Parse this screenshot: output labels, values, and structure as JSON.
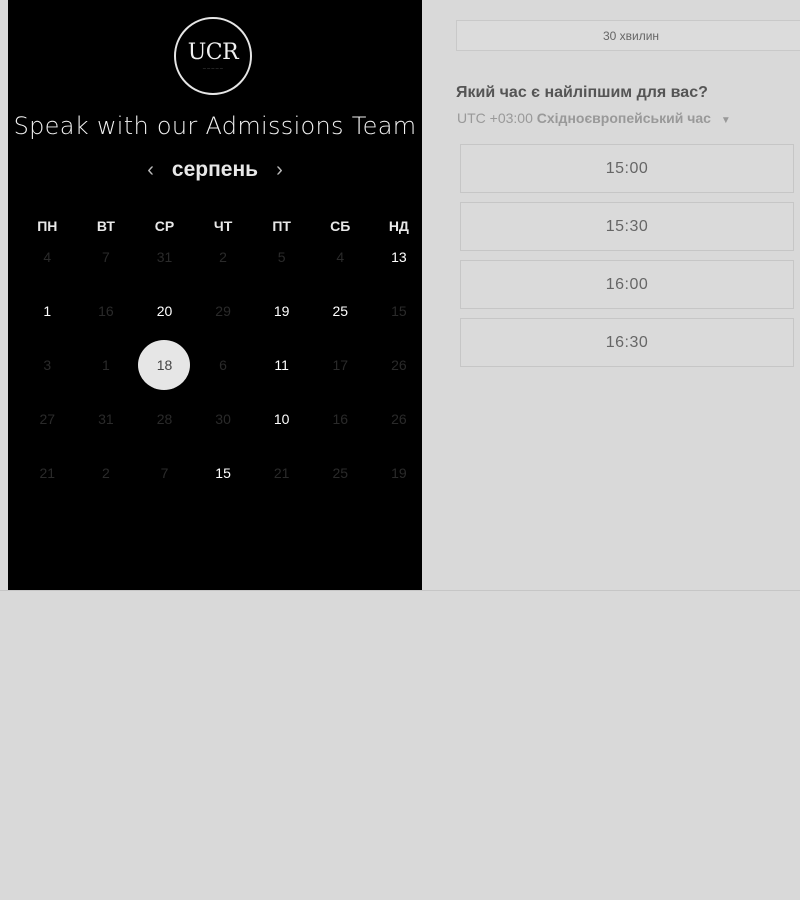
{
  "calendar": {
    "title": "Speak with our Admissions Team",
    "month": "серпень",
    "prev_icon": "‹",
    "next_icon": "›",
    "logo_text": "UCR",
    "weekdays": [
      "ПН",
      "ВТ",
      "СР",
      "ЧТ",
      "ПТ",
      "СБ",
      "НД"
    ],
    "rows": [
      [
        "4",
        "7",
        "31",
        "2",
        "5",
        "4",
        "13"
      ],
      [
        "1",
        "16",
        "20",
        "29",
        "19",
        "25",
        "15"
      ],
      [
        "3",
        "1",
        "18",
        "6",
        "11",
        "17",
        "26"
      ],
      [
        "27",
        "31",
        "28",
        "30",
        "10",
        "16",
        "26"
      ],
      [
        "21",
        "2",
        "7",
        "15",
        "21",
        "25",
        "19"
      ]
    ],
    "available": [
      [
        false,
        false,
        false,
        false,
        false,
        false,
        true
      ],
      [
        true,
        false,
        true,
        false,
        true,
        true,
        false
      ],
      [
        false,
        false,
        true,
        false,
        true,
        false,
        false
      ],
      [
        false,
        false,
        false,
        false,
        true,
        false,
        false
      ],
      [
        false,
        false,
        false,
        true,
        false,
        false,
        false
      ]
    ],
    "selected": {
      "row": 2,
      "col": 2
    }
  },
  "booking": {
    "duration": "30 хвилин",
    "question": "Який час є найліпшим для вас?",
    "timezone_offset": "UTC +03:00",
    "timezone_name": "Східноєвропейський час",
    "slots": [
      "15:00",
      "15:30",
      "16:00",
      "16:30"
    ]
  }
}
